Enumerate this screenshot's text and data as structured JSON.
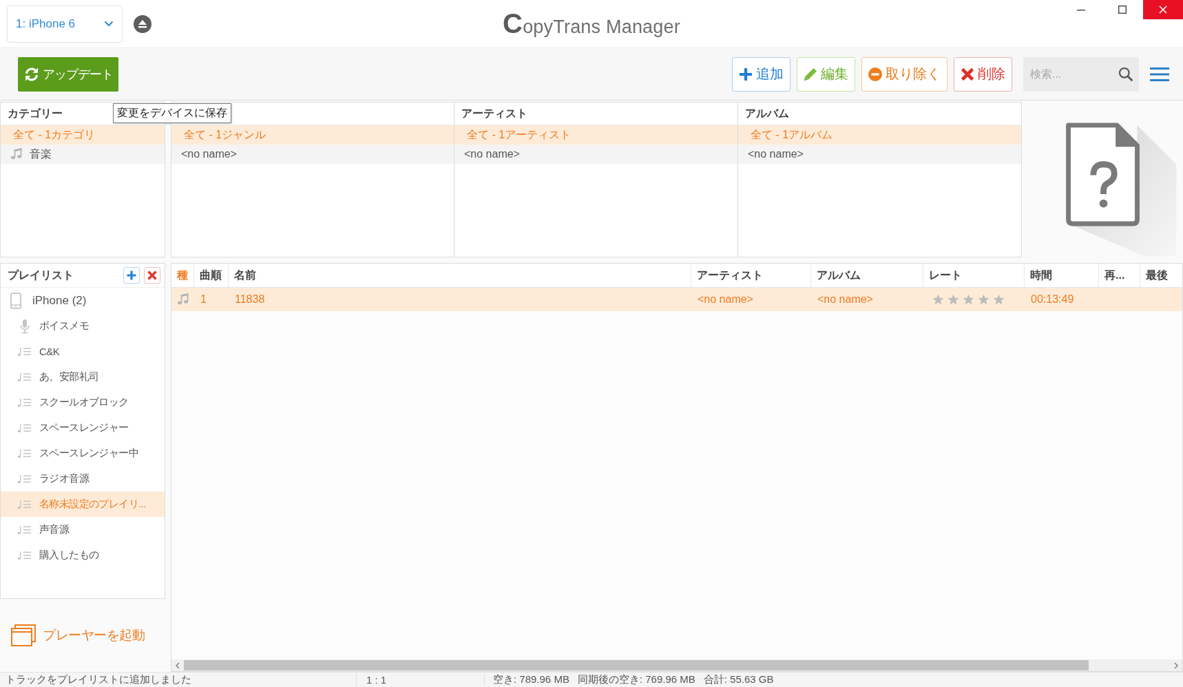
{
  "title_bar": {
    "device_selector": "1: iPhone 6",
    "app_title": "CopyTrans Manager"
  },
  "toolbar": {
    "update_button": "アップデート",
    "actions": [
      {
        "kind": "add",
        "label": "追加"
      },
      {
        "kind": "edit",
        "label": "編集"
      },
      {
        "kind": "remove",
        "label": "取り除く"
      },
      {
        "kind": "delete",
        "label": "削除"
      }
    ],
    "search": {
      "placeholder": "検索..."
    }
  },
  "tooltip": "変更をデバイスに保存",
  "browser": {
    "columns": [
      {
        "header": "カテゴリー",
        "items": [
          {
            "label": "全て - 1カテゴリ",
            "kind": "all",
            "selected": true
          },
          {
            "label": "音楽",
            "kind": "music",
            "selected": false
          }
        ]
      },
      {
        "items": [
          {
            "label": "全て - 1ジャンル",
            "kind": "all",
            "selected": true
          },
          {
            "label": "<no name>",
            "kind": "entry",
            "selected": false
          }
        ]
      },
      {
        "header": "アーティスト",
        "items": [
          {
            "label": "全て - 1アーティスト",
            "kind": "all",
            "selected": true
          },
          {
            "label": "<no name>",
            "kind": "entry",
            "selected": false
          }
        ]
      },
      {
        "header": "アルバム",
        "items": [
          {
            "label": "全て - 1アルバム",
            "kind": "all",
            "selected": true
          },
          {
            "label": "<no name>",
            "kind": "entry",
            "selected": false
          }
        ]
      }
    ]
  },
  "playlists": {
    "title": "プレイリスト",
    "items": [
      {
        "label": "iPhone (2)",
        "kind": "device",
        "selected": false,
        "children": [
          {
            "label": "ボイスメモ",
            "kind": "voice_memos",
            "selected": false
          },
          {
            "label": "C&K",
            "kind": "playlist",
            "selected": false
          },
          {
            "label": "あ、安部礼司",
            "kind": "playlist",
            "selected": false
          },
          {
            "label": "スクールオブロック",
            "kind": "playlist",
            "selected": false
          },
          {
            "label": "スペースレンジャー",
            "kind": "playlist",
            "selected": false
          },
          {
            "label": "スペースレンジャー中",
            "kind": "playlist",
            "selected": false
          },
          {
            "label": "ラジオ音源",
            "kind": "playlist",
            "selected": false
          },
          {
            "label": "名称未設定のプレイリ...",
            "kind": "playlist",
            "selected": true
          },
          {
            "label": "声音源",
            "kind": "playlist",
            "selected": false
          },
          {
            "label": "購入したもの",
            "kind": "playlist",
            "selected": false
          }
        ]
      }
    ]
  },
  "launch_player": "プレーヤーを起動",
  "tracks": {
    "columns": [
      {
        "label": "種",
        "sorted": true
      },
      {
        "label": "曲順",
        "sorted": false
      },
      {
        "label": "名前",
        "sorted": false
      },
      {
        "label": "アーティスト",
        "sorted": false
      },
      {
        "label": "アルバム",
        "sorted": false
      },
      {
        "label": "レート",
        "sorted": false
      },
      {
        "label": "時間",
        "sorted": false
      },
      {
        "label": "再...",
        "sorted": false
      },
      {
        "label": "最後",
        "sorted": false
      }
    ],
    "rows": [
      {
        "kind": "music",
        "number": "1",
        "name": "11838",
        "artist": "<no name>",
        "album": "<no name>",
        "stars": 0,
        "time": "00:13:49",
        "selected": true
      }
    ]
  },
  "status_bar": {
    "message": "トラックをプレイリストに追加しました",
    "count": "1 : 1",
    "storage": [
      "空き: 789.96 MB",
      "同期後の空き: 769.96 MB",
      "合計: 55.63 GB"
    ]
  }
}
